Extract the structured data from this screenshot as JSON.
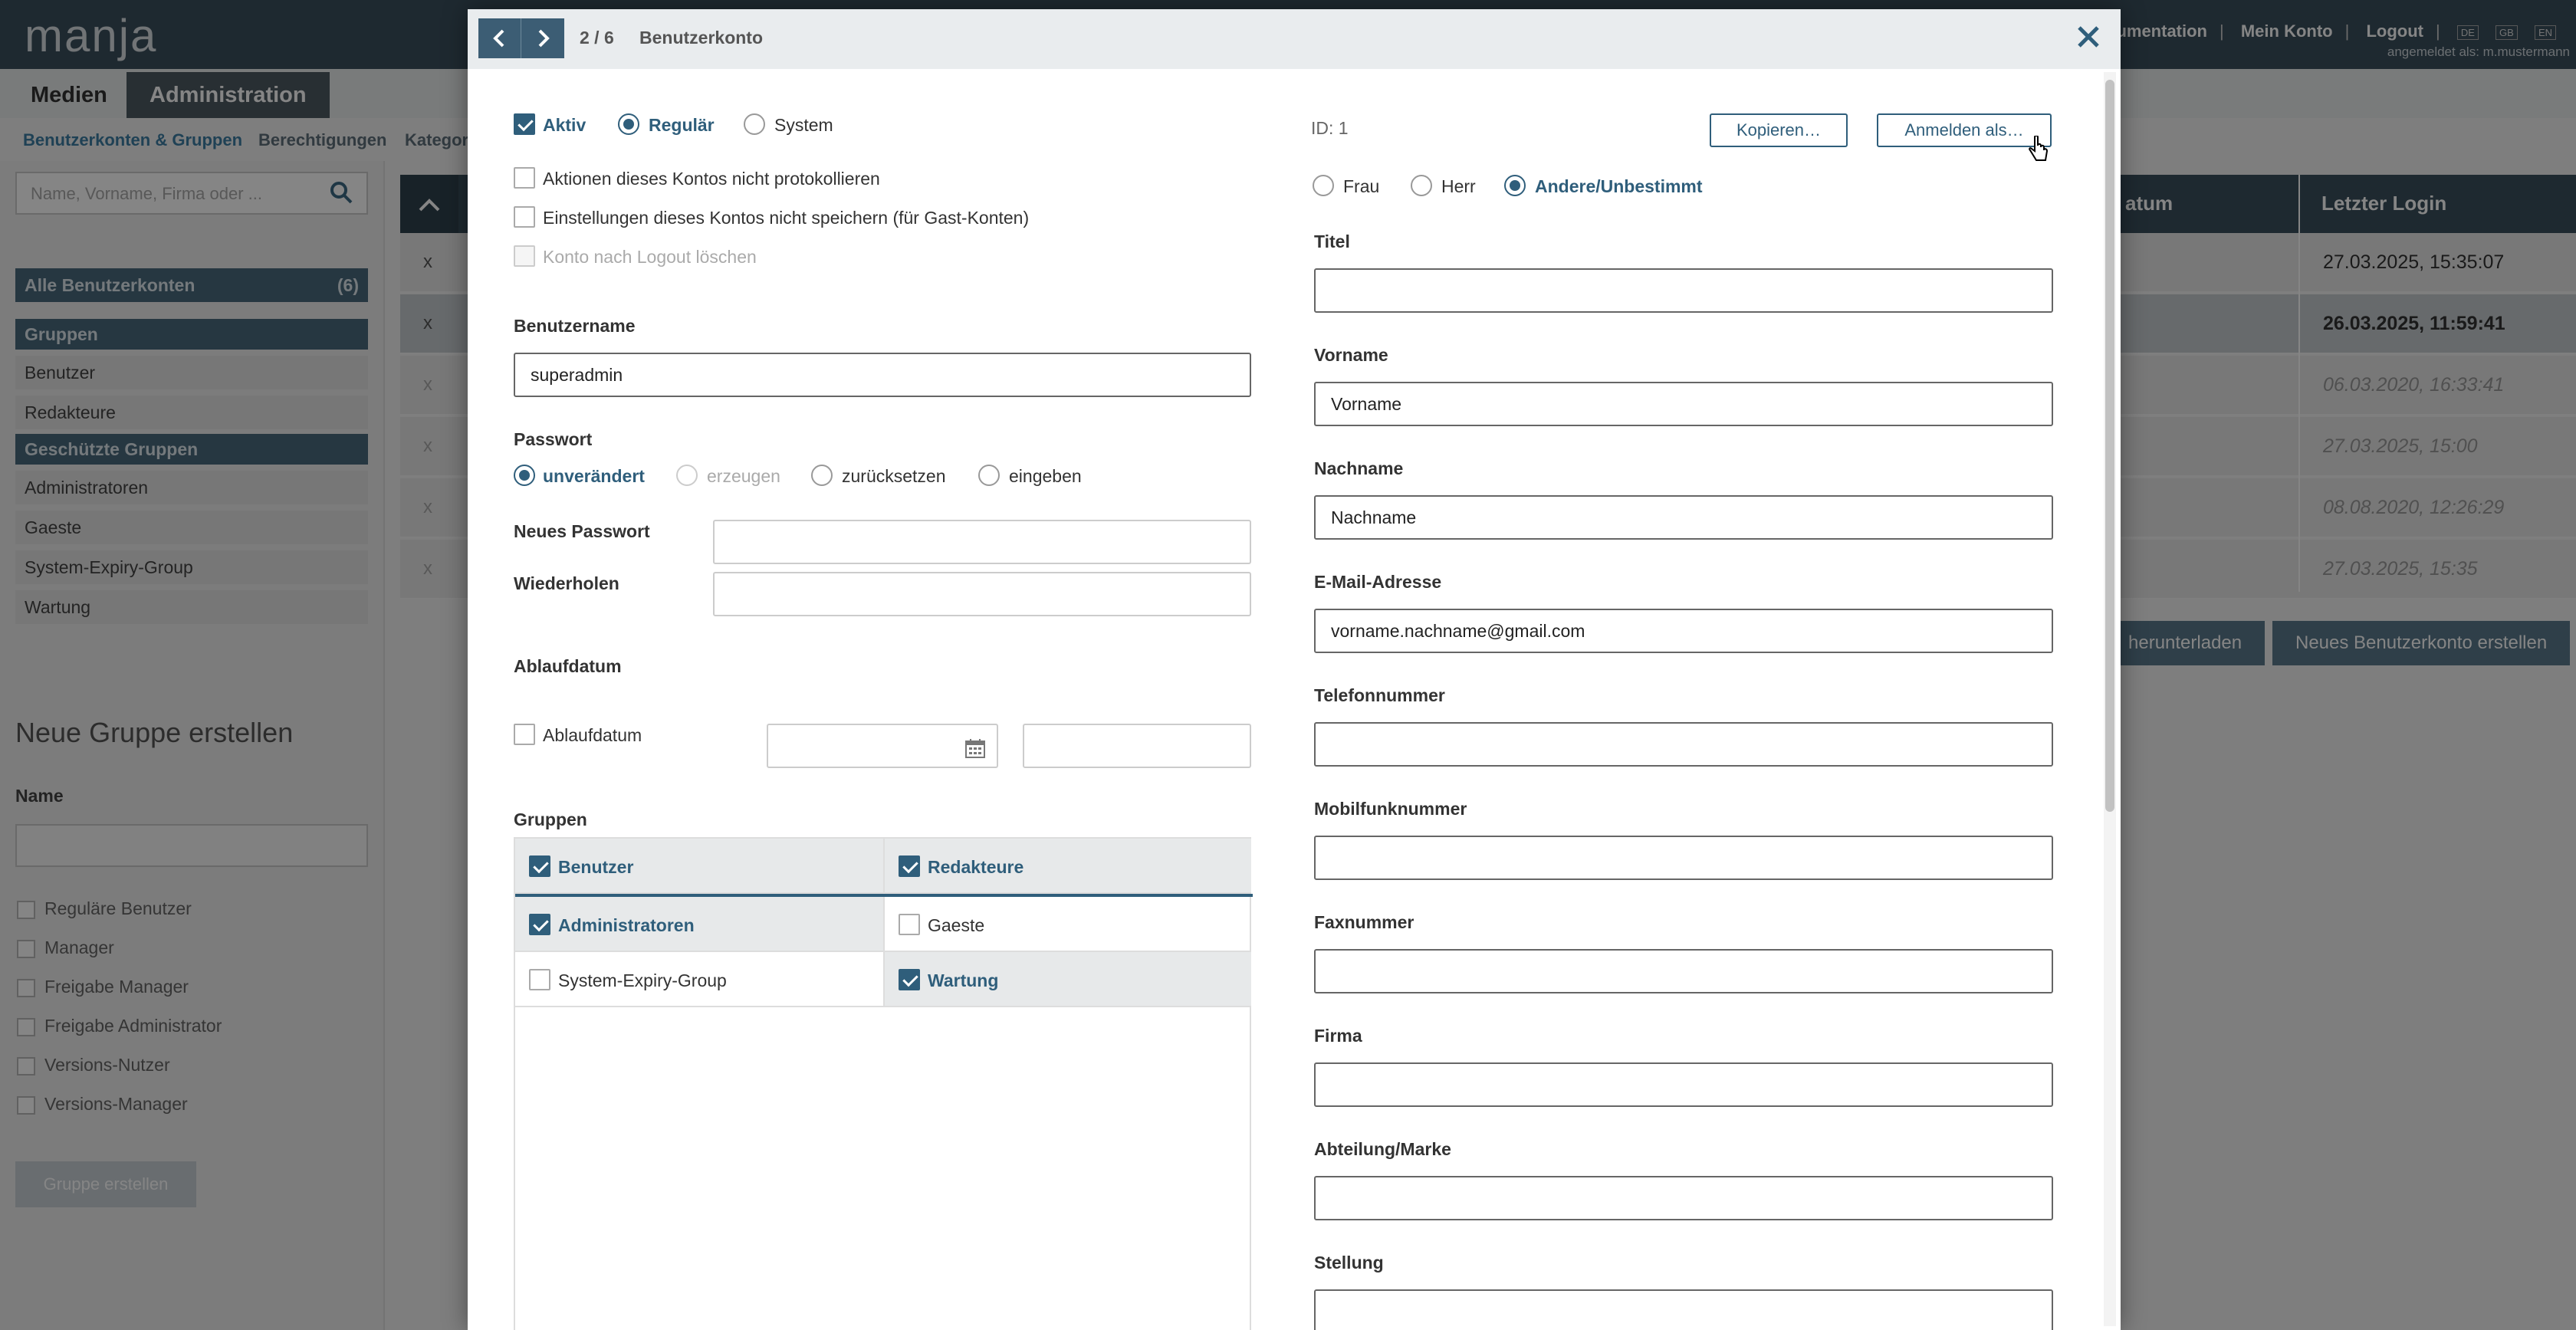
{
  "app": {
    "logo": "manja",
    "topnav": [
      "kumentation",
      "Mein Konto",
      "Logout"
    ],
    "languages": [
      "DE",
      "GB",
      "EN"
    ],
    "logged_in": "angemeldet als: m.mustermann"
  },
  "mainnav": {
    "medien": "Medien",
    "administration": "Administration"
  },
  "subnav": [
    "Benutzerkonten & Gruppen",
    "Berechtigungen",
    "Kategor"
  ],
  "sidebar": {
    "search_placeholder": "Name, Vorname, Firma oder ...",
    "all_accounts": "Alle Benutzerkonten",
    "all_accounts_count": "(6)",
    "groups_header": "Gruppen",
    "groups": [
      "Benutzer",
      "Redakteure"
    ],
    "protected_header": "Geschützte Gruppen",
    "protected_groups": [
      "Administratoren",
      "Gaeste",
      "System-Expiry-Group",
      "Wartung"
    ],
    "new_group_title": "Neue Gruppe erstellen",
    "name_label": "Name",
    "rights": [
      "Reguläre Benutzer",
      "Manager",
      "Freigabe Manager",
      "Freigabe Administrator",
      "Versions-Nutzer",
      "Versions-Manager"
    ],
    "create_button": "Gruppe erstellen"
  },
  "table": {
    "col_date": "atum",
    "col_last_login": "Letzter Login",
    "rows": [
      {
        "x": "x",
        "login": "27.03.2025, 15:35:07"
      },
      {
        "x": "x",
        "login": "26.03.2025, 11:59:41"
      },
      {
        "x": "x",
        "login": "06.03.2020, 16:33:41"
      },
      {
        "x": "x",
        "login": "27.03.2025, 15:00"
      },
      {
        "x": "x",
        "login": "08.08.2020, 12:26:29"
      },
      {
        "x": "x",
        "login": "27.03.2025, 15:35"
      }
    ],
    "download_button": "herunterladen",
    "new_account_button": "Neues Benutzerkonto erstellen"
  },
  "modal": {
    "pager": "2 / 6",
    "title": "Benutzerkonto",
    "status": {
      "active": "Aktiv",
      "regular": "Regulär",
      "system": "System"
    },
    "options": [
      "Aktionen dieses Kontos nicht protokollieren",
      "Einstellungen dieses Kontos nicht speichern (für Gast-Konten)",
      "Konto nach Logout löschen"
    ],
    "username_label": "Benutzername",
    "username_value": "superadmin",
    "password_label": "Passwort",
    "password_modes": [
      "unverändert",
      "erzeugen",
      "zurücksetzen",
      "eingeben"
    ],
    "new_password_label": "Neues Passwort",
    "repeat_label": "Wiederholen",
    "expiry_section": "Ablaufdatum",
    "expiry_checkbox": "Ablaufdatum",
    "groups_label": "Gruppen",
    "groups": [
      {
        "name": "Benutzer",
        "checked": true
      },
      {
        "name": "Redakteure",
        "checked": true
      },
      {
        "name": "Administratoren",
        "checked": true
      },
      {
        "name": "Gaeste",
        "checked": false
      },
      {
        "name": "System-Expiry-Group",
        "checked": false
      },
      {
        "name": "Wartung",
        "checked": true
      }
    ],
    "id_label": "ID: 1",
    "copy_button": "Kopieren…",
    "login_as_button": "Anmelden als…",
    "salutation": [
      "Frau",
      "Herr",
      "Andere/Unbestimmt"
    ],
    "fields": {
      "title": "Titel",
      "firstname": "Vorname",
      "firstname_value": "Vorname",
      "lastname": "Nachname",
      "lastname_value": "Nachname",
      "email": "E-Mail-Adresse",
      "email_value": "vorname.nachname@gmail.com",
      "phone": "Telefonnummer",
      "mobile": "Mobilfunknummer",
      "fax": "Faxnummer",
      "company": "Firma",
      "department": "Abteilung/Marke",
      "position": "Stellung"
    }
  }
}
